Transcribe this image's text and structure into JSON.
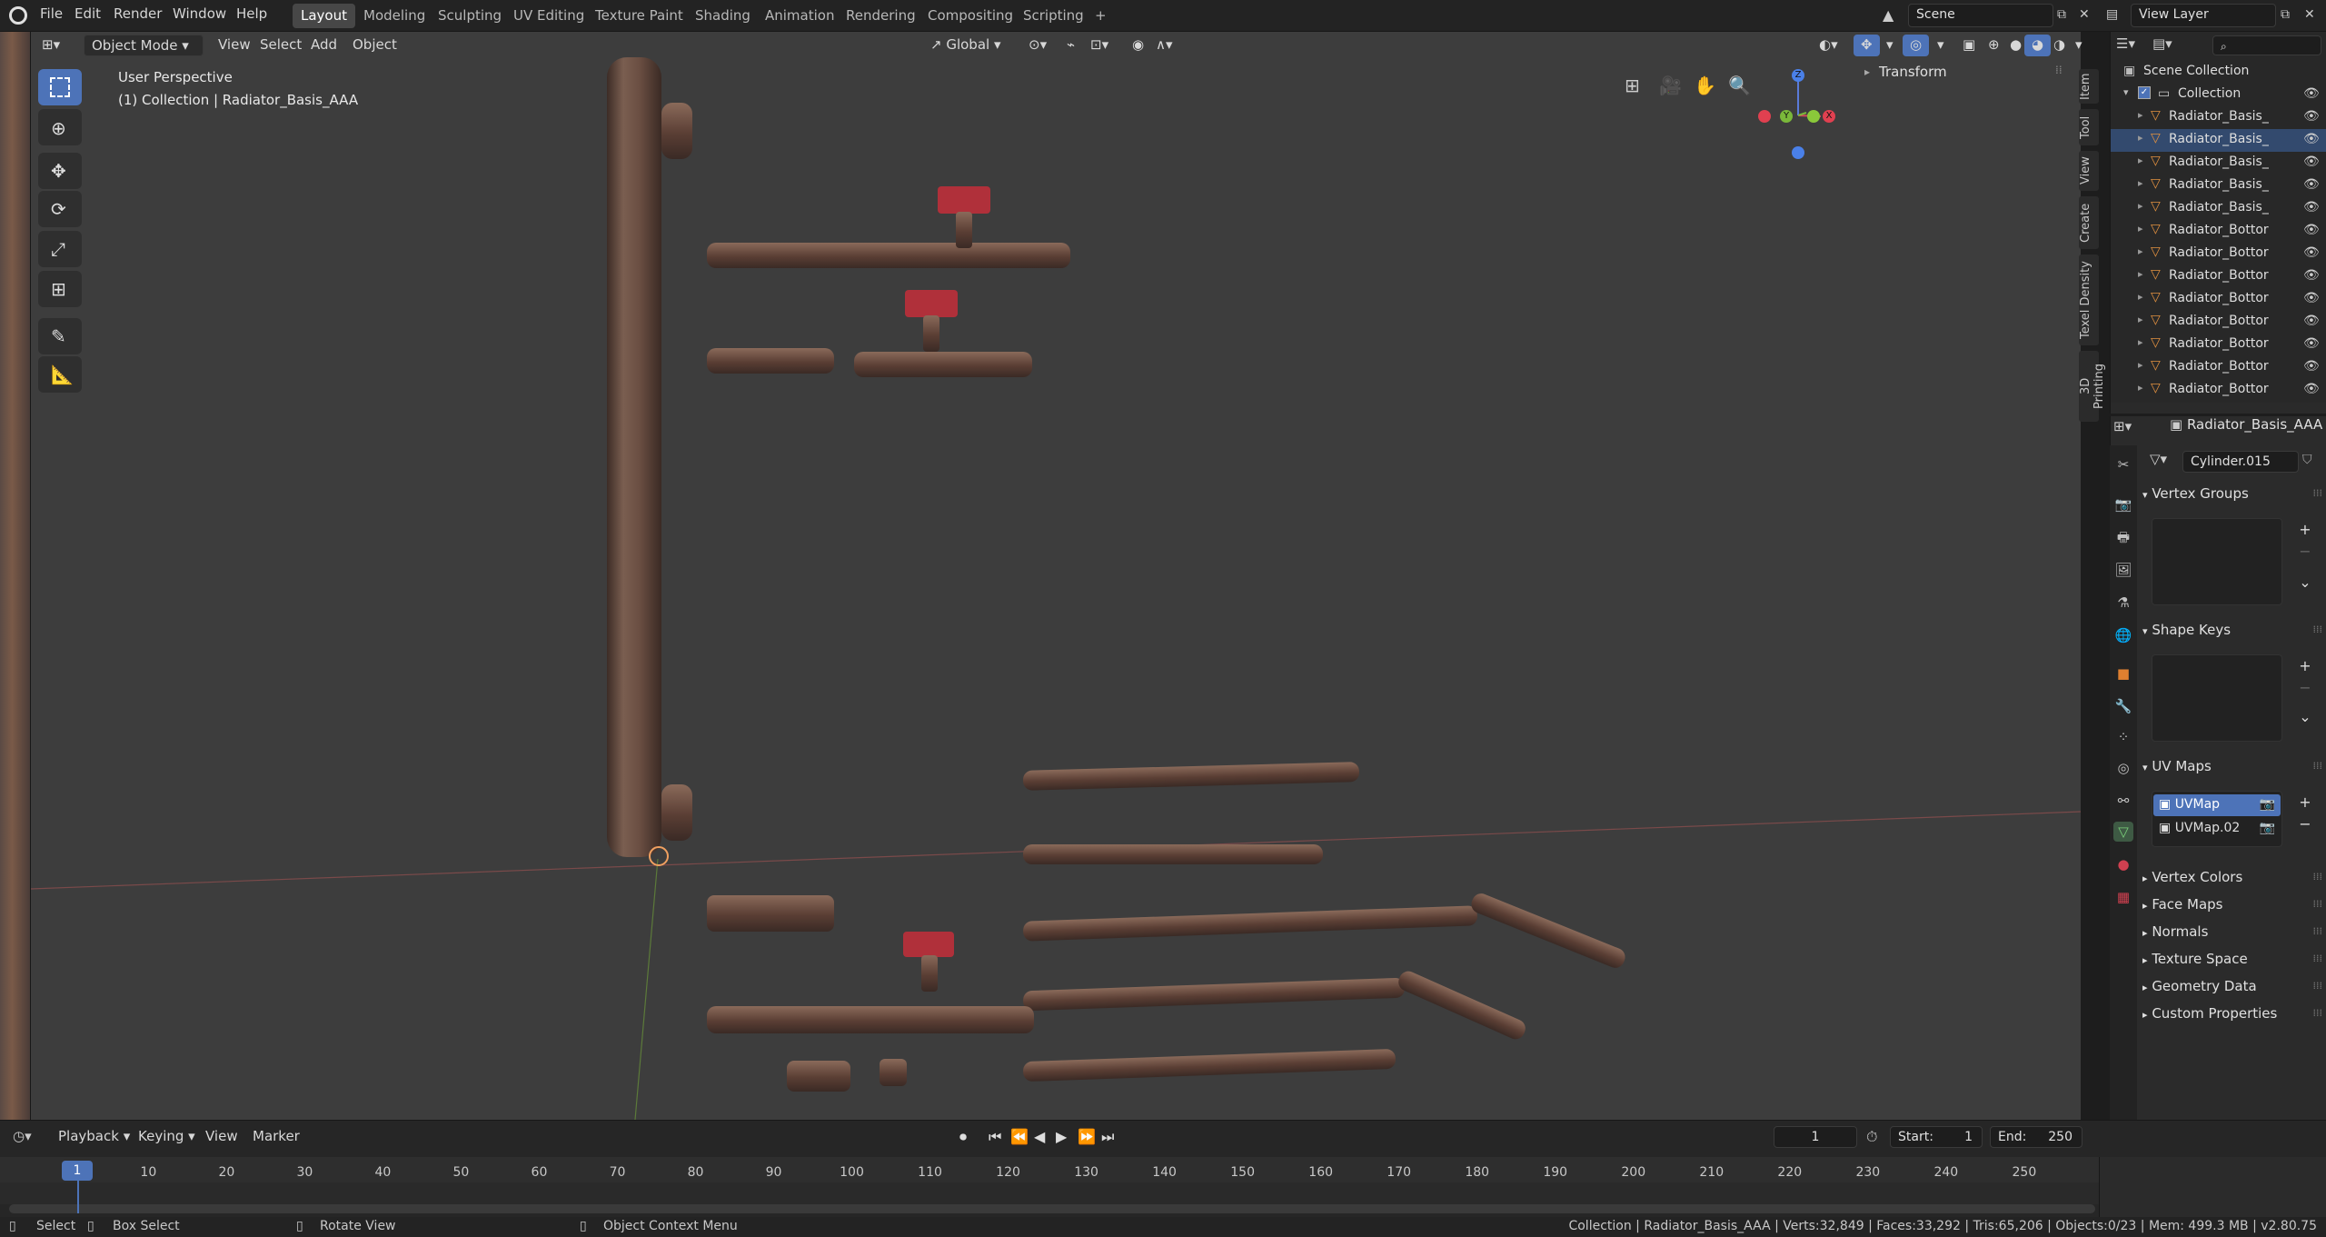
{
  "menubar": {
    "items": [
      "File",
      "Edit",
      "Render",
      "Window",
      "Help"
    ],
    "workspaces": [
      "Layout",
      "Modeling",
      "Sculpting",
      "UV Editing",
      "Texture Paint",
      "Shading",
      "Animation",
      "Rendering",
      "Compositing",
      "Scripting"
    ],
    "add_tab": "+",
    "scene": "Scene",
    "view_layer": "View Layer"
  },
  "viewport_header": {
    "mode": "Object Mode",
    "menus": [
      "View",
      "Select",
      "Add",
      "Object"
    ],
    "transform_orientation": "Global"
  },
  "viewport": {
    "perspective": "User Perspective",
    "collection_info": "(1) Collection | Radiator_Basis_AAA",
    "gizmo": {
      "z": "Z",
      "y": "Y",
      "x": "X"
    },
    "n_panel_header": "Transform"
  },
  "side_tabs": [
    "Item",
    "Tool",
    "View",
    "Create",
    "Texel Density",
    "3D Printing"
  ],
  "outliner": {
    "root": "Scene Collection",
    "collection": "Collection",
    "objects": [
      "Radiator_Basis_",
      "Radiator_Basis_",
      "Radiator_Basis_",
      "Radiator_Basis_",
      "Radiator_Basis_",
      "Radiator_Bottor",
      "Radiator_Bottor",
      "Radiator_Bottor",
      "Radiator_Bottor",
      "Radiator_Bottor",
      "Radiator_Bottor",
      "Radiator_Bottor",
      "Radiator_Bottor"
    ]
  },
  "properties": {
    "object_name": "Radiator_Basis_AAA",
    "mesh_name": "Cylinder.015",
    "panels_open": [
      "Vertex Groups",
      "Shape Keys",
      "UV Maps"
    ],
    "uv_maps": [
      "UVMap",
      "UVMap.02"
    ],
    "panels_closed": [
      "Vertex Colors",
      "Face Maps",
      "Normals",
      "Texture Space",
      "Geometry Data",
      "Custom Properties"
    ]
  },
  "timeline": {
    "menus": [
      "Playback",
      "Keying",
      "View",
      "Marker"
    ],
    "current_frame": "1",
    "start_label": "Start:",
    "start": "1",
    "end_label": "End:",
    "end": "250",
    "ticks": [
      "1",
      "10",
      "20",
      "30",
      "40",
      "50",
      "60",
      "70",
      "80",
      "90",
      "100",
      "110",
      "120",
      "130",
      "140",
      "150",
      "160",
      "170",
      "180",
      "190",
      "200",
      "210",
      "220",
      "230",
      "240",
      "250"
    ]
  },
  "statusbar": {
    "select": "Select",
    "box_select": "Box Select",
    "rotate_view": "Rotate View",
    "context_menu": "Object Context Menu",
    "stats": "Collection | Radiator_Basis_AAA | Verts:32,849 | Faces:33,292 | Tris:65,206 | Objects:0/23 | Mem: 499.3 MB | v2.80.75"
  },
  "colors": {
    "accent": "#4d73b8",
    "active_tab": "#474747",
    "viewport_bg": "#3d3d3d",
    "valve_red": "#b0303a"
  }
}
